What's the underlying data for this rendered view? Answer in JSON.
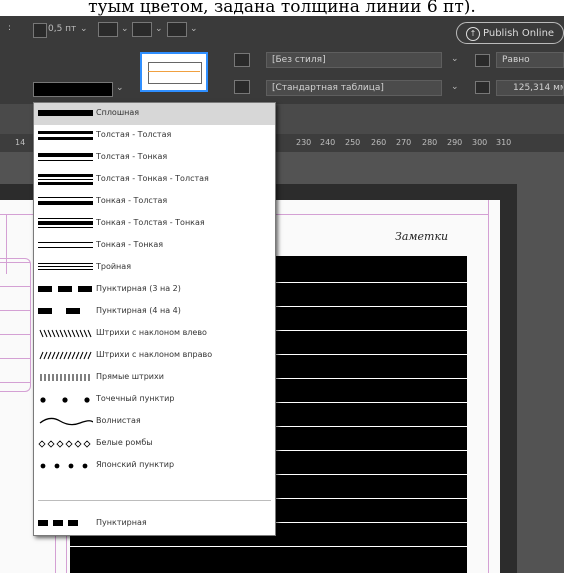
{
  "caption_text": "туым цветом, задана толщина линии 6 пт).",
  "toolbar": {
    "publish_label": "Publish Online",
    "stroke_weight": "0,5 пт",
    "object_style": "[Без стиля]",
    "table_style": "[Стандартная таблица]",
    "align_label": "Равно",
    "size_value": "125,314 мм"
  },
  "ruler_ticks": [
    "14",
    "230",
    "240",
    "250",
    "260",
    "270",
    "280",
    "290",
    "300",
    "310"
  ],
  "page": {
    "notes_label": "Заметки"
  },
  "stroke_menu": {
    "items": [
      {
        "label": "Сплошная",
        "type": "solid"
      },
      {
        "label": "Толстая - Толстая",
        "type": "thick-thick"
      },
      {
        "label": "Толстая - Тонкая",
        "type": "thick-thin"
      },
      {
        "label": "Толстая - Тонкая - Толстая",
        "type": "thick-thin-thick"
      },
      {
        "label": "Тонкая - Толстая",
        "type": "thin-thick"
      },
      {
        "label": "Тонкая - Толстая - Тонкая",
        "type": "thin-thick-thin"
      },
      {
        "label": "Тонкая - Тонкая",
        "type": "thin-thin"
      },
      {
        "label": "Тройная",
        "type": "triple"
      },
      {
        "label": "Пунктирная (3 на 2)",
        "type": "dashed-3-2"
      },
      {
        "label": "Пунктирная (4 на 4)",
        "type": "dashed-4-4"
      },
      {
        "label": "Штрихи с наклоном влево",
        "type": "left-slant"
      },
      {
        "label": "Штрихи с наклоном вправо",
        "type": "right-slant"
      },
      {
        "label": "Прямые штрихи",
        "type": "straight-hash"
      },
      {
        "label": "Точечный пунктир",
        "type": "dotted"
      },
      {
        "label": "Волнистая",
        "type": "wavy"
      },
      {
        "label": "Белые ромбы",
        "type": "white-diamonds"
      },
      {
        "label": "Японский пунктир",
        "type": "japanese-dots"
      }
    ],
    "footer_item": {
      "label": "Пунктирная",
      "type": "dashed"
    },
    "selected_index": 0
  },
  "colors": {
    "ui_dark": "#3a3a3a",
    "selection": "#d7d7d7",
    "page_frame": "#d4a0d4"
  }
}
